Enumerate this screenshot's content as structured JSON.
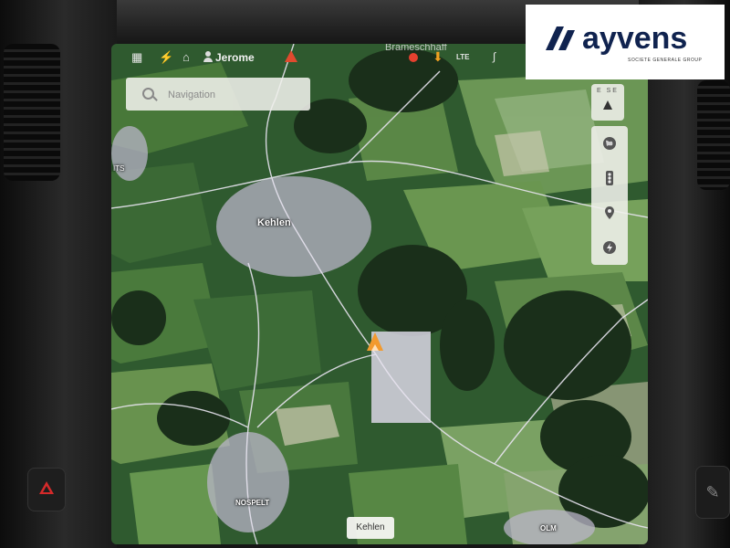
{
  "status_bar": {
    "user_name": "Jerome",
    "network": "LTE",
    "place_overlay": "Brameschhaff"
  },
  "search": {
    "placeholder": "Navigation"
  },
  "compass": {
    "label": "E SE"
  },
  "controls": [
    {
      "name": "satellite-view-icon"
    },
    {
      "name": "traffic-icon"
    },
    {
      "name": "pin-icon"
    },
    {
      "name": "charging-icon"
    }
  ],
  "map": {
    "labels": {
      "kehlen": "Kehlen",
      "nospelt": "NOSPELT",
      "olm": "OLM",
      "edge": "ITS"
    },
    "current_location_label": "Kehlen"
  },
  "brand": {
    "name": "ayvens",
    "tagline": "SOCIETE GENERALE GROUP"
  },
  "colors": {
    "nav_arrow": "#f29a2e",
    "warning": "#e04a2e",
    "record": "#e5412f",
    "brand_navy": "#10234f"
  }
}
